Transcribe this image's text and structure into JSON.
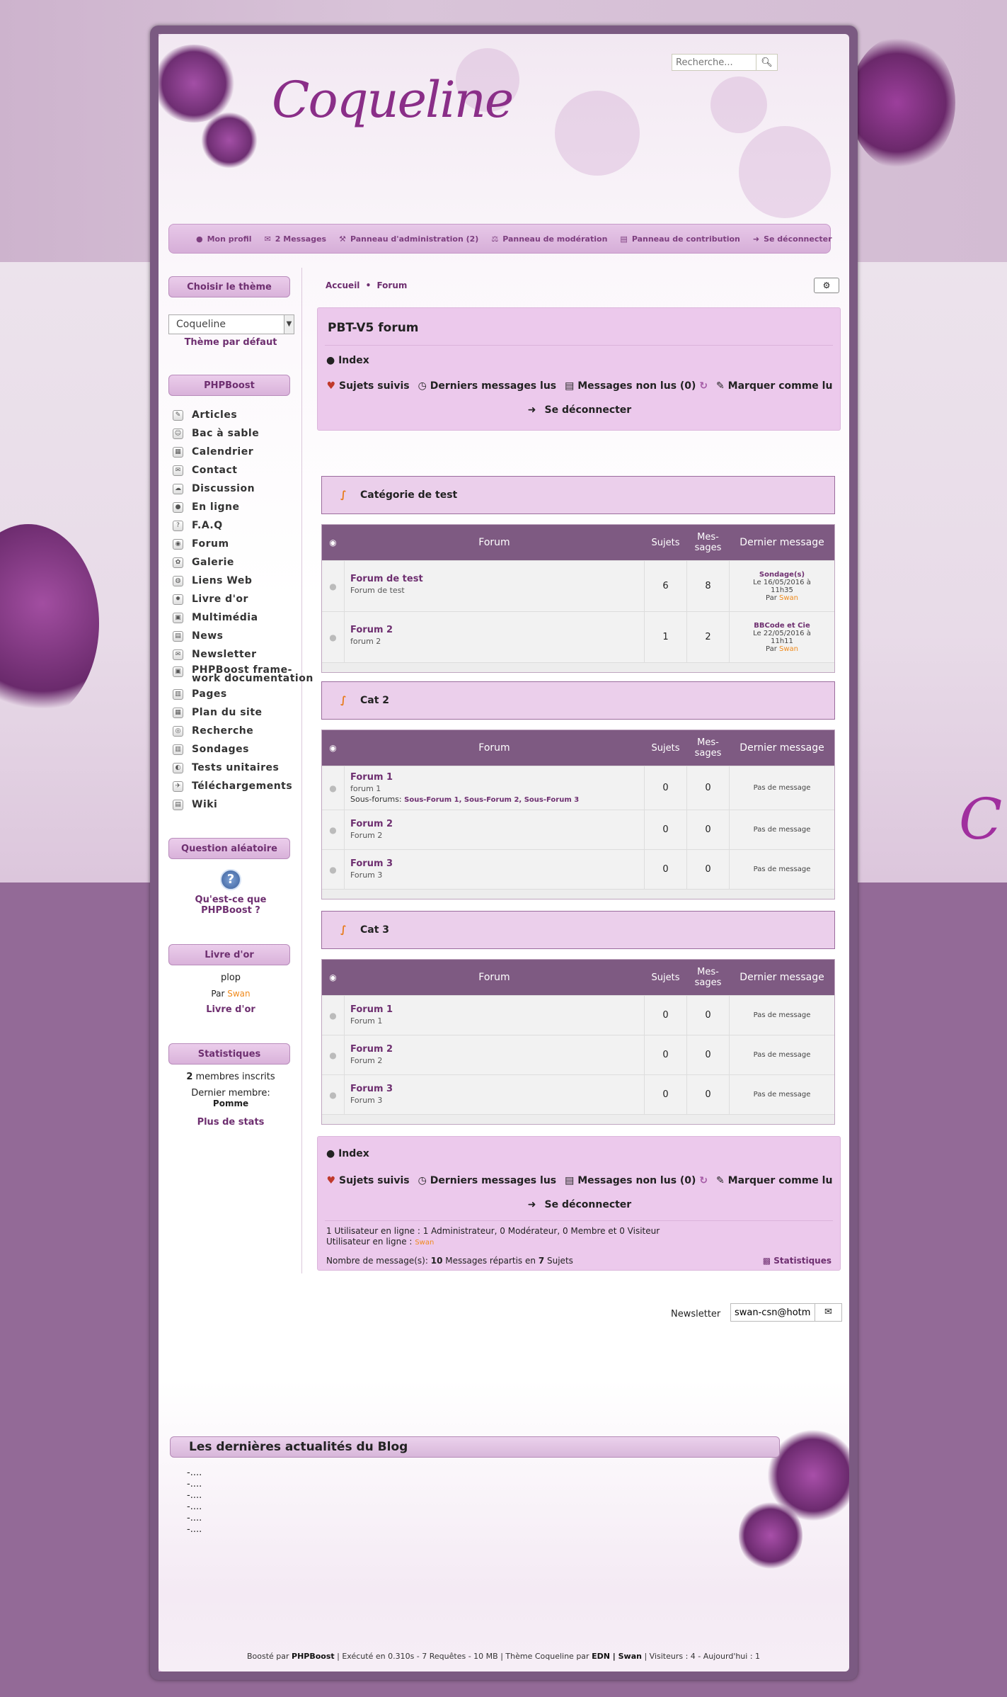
{
  "header": {
    "logo": "Coqueline",
    "search_placeholder": "Recherche...",
    "search_icon": "search-icon"
  },
  "toolbar": [
    {
      "icon": "user-icon",
      "label": "Mon profil"
    },
    {
      "icon": "envelope-icon",
      "label": "2 Messages"
    },
    {
      "icon": "wrench-icon",
      "label": "Panneau d'administration (2)"
    },
    {
      "icon": "gavel-icon",
      "label": "Panneau de modération"
    },
    {
      "icon": "file-icon",
      "label": "Panneau de contribution"
    },
    {
      "icon": "sign-out-icon",
      "label": "Se déconnecter"
    }
  ],
  "sidebar": {
    "theme_title": "Choisir le thème",
    "theme_selected": "Coqueline",
    "theme_default_link": "Thème par défaut",
    "menu_title": "PHPBoost",
    "menu_items": [
      "Articles",
      "Bac à sable",
      "Calendrier",
      "Contact",
      "Discussion",
      "En ligne",
      "F.A.Q",
      "Forum",
      "Galerie",
      "Liens Web",
      "Livre d'or",
      "Multimédia",
      "News",
      "Newsletter",
      "PHPBoost frame-\nwork documentation",
      "Pages",
      "Plan du site",
      "Recherche",
      "Sondages",
      "Tests unitaires",
      "Téléchargements",
      "Wiki"
    ],
    "question_title": "Question aléatoire",
    "question_text": "Qu'est-ce que PHPBoost ?",
    "guestbook_title": "Livre d'or",
    "guestbook_message": "plop",
    "guestbook_by": "Par",
    "guestbook_author": "Swan",
    "guestbook_link": "Livre d'or",
    "stats_title": "Statistiques",
    "stats_members_count": "2",
    "stats_members_label": "membres inscrits",
    "stats_last_member_label": "Dernier membre:",
    "stats_last_member": "Pomme",
    "stats_more": "Plus de stats"
  },
  "main": {
    "breadcrumb": [
      "Accueil",
      "Forum"
    ],
    "forum_title": "PBT-V5 forum",
    "index_label": "Index",
    "quick_links": [
      "Sujets suivis",
      "Derniers messages lus",
      "Messages non lus (0)",
      "Marquer comme lu"
    ],
    "logout": "Se déconnecter",
    "table_headers": {
      "forum": "Forum",
      "topics": "Sujets",
      "messages": "Mes-\nsages",
      "last": "Dernier message"
    },
    "categories": [
      {
        "name": "Catégorie de test",
        "forums": [
          {
            "name": "Forum de test",
            "desc": "Forum de test",
            "topics": "6",
            "messages": "8",
            "last_title": "Sondage(s)",
            "last_date": "Le 16/05/2016 à 11h35",
            "last_by": "Par",
            "last_user": "Swan"
          },
          {
            "name": "Forum 2",
            "desc": "forum 2",
            "topics": "1",
            "messages": "2",
            "last_title": "BBCode et Cie",
            "last_date": "Le 22/05/2016 à 11h11",
            "last_by": "Par",
            "last_user": "Swan"
          }
        ]
      },
      {
        "name": "Cat 2",
        "forums": [
          {
            "name": "Forum 1",
            "desc": "forum 1",
            "subforums_label": "Sous-forums:",
            "subforums": "Sous-Forum 1, Sous-Forum 2, Sous-Forum 3",
            "topics": "0",
            "messages": "0",
            "no_message": "Pas de message"
          },
          {
            "name": "Forum 2",
            "desc": "Forum 2",
            "topics": "0",
            "messages": "0",
            "no_message": "Pas de message"
          },
          {
            "name": "Forum 3",
            "desc": "Forum 3",
            "topics": "0",
            "messages": "0",
            "no_message": "Pas de message"
          }
        ]
      },
      {
        "name": "Cat 3",
        "forums": [
          {
            "name": "Forum 1",
            "desc": "Forum 1",
            "topics": "0",
            "messages": "0",
            "no_message": "Pas de message"
          },
          {
            "name": "Forum 2",
            "desc": "Forum 2",
            "topics": "0",
            "messages": "0",
            "no_message": "Pas de message"
          },
          {
            "name": "Forum 3",
            "desc": "Forum 3",
            "topics": "0",
            "messages": "0",
            "no_message": "Pas de message"
          }
        ]
      }
    ],
    "online_line": "1 Utilisateur en ligne : 1 Administrateur, 0 Modérateur, 0 Membre et 0 Visiteur",
    "online_users_label": "Utilisateur en ligne :",
    "online_user": "Swan",
    "messages_prefix": "Nombre de message(s):",
    "messages_count": "10",
    "messages_mid": "Messages répartis en",
    "topics_count": "7",
    "topics_suffix": "Sujets",
    "stats_link": "Statistiques"
  },
  "newsletter": {
    "label": "Newsletter",
    "email": "swan-csn@hotma"
  },
  "blog": {
    "title": "Les dernières actualités du Blog",
    "items": [
      "-....",
      "-....",
      "-....",
      "-....",
      "-....",
      "-...."
    ]
  },
  "footer": {
    "boosted_by": "Boosté par",
    "phpboost": "PHPBoost",
    "exec": "| Exécuté en 0.310s - 7 Requêtes - 10 MB | Thème Coqueline par",
    "edn": "EDN | Swan",
    "visitors": "| Visiteurs : 4 - Aujourd'hui : 1"
  },
  "colors": {
    "accent": "#6e2f70",
    "header_bar": "#7e5a82",
    "category_bg": "#ebcfeb",
    "highlight": "#f08a1c"
  }
}
